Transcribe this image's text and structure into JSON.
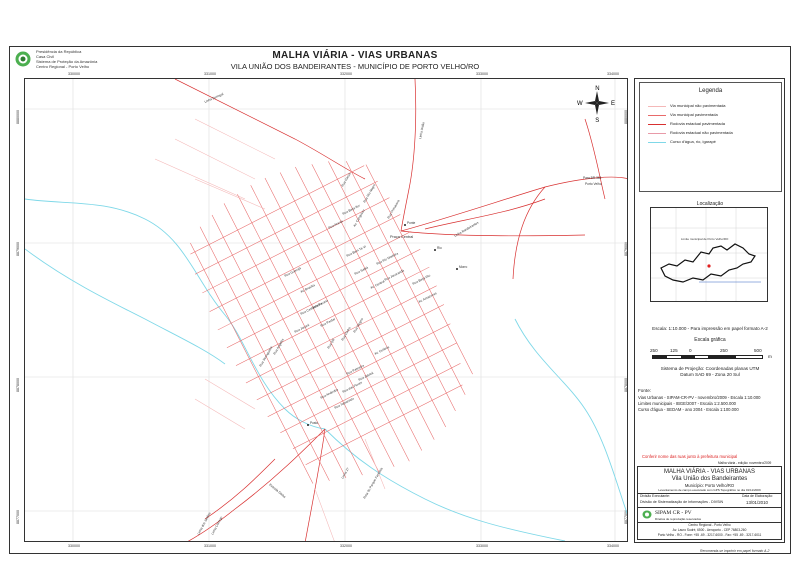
{
  "header": {
    "org_lines": [
      "Presidência da República",
      "Casa Civil",
      "Sistema de Proteção da Amazônia",
      "Centro Regional - Porto Velho"
    ],
    "title": "MALHA VIÁRIA - VIAS URBANAS",
    "subtitle": "VILA  UNIÃO DOS BANDEIRANTES -  MUNICÍPIO DE PORTO VELHO/RO"
  },
  "map": {
    "x_ticks": [
      "330000",
      "331000",
      "332000",
      "333000",
      "334000"
    ],
    "y_ticks": [
      "8880000",
      "8879000",
      "8878000",
      "8877000"
    ],
    "place_label": "Praça Central",
    "road_labels": {
      "ro_205": "Para BR-364",
      "porto_velho": "Porto Velho",
      "seringal": "Linha Seringal",
      "uniao": "Linha União",
      "bandeirantes": "Linha Bandeirantes",
      "jardins": "Linha dos Jardins",
      "corrego": "Linha Córrego",
      "estrada": "Estrada Gleba",
      "linha27": "Linha 27",
      "rota": "Rota do Parque Fantasia"
    },
    "street_labels": [
      "Rua Garça",
      "Rua Rio Negro",
      "Av. Cangussu",
      "Rua Beija-flor",
      "Rua Primavera",
      "Rua Araras",
      "Rua Bem-Te-Vi",
      "Rua Sabiá",
      "Av. Central",
      "Rua Guarujá",
      "Av. Brasília",
      "Rua Tucano",
      "Rua Pardal",
      "Rua Jacaré",
      "Rua Castanheira",
      "Rua Rio Madeira",
      "Rua Jacarandá",
      "Rua Beija-Rio",
      "Av. Amazonas",
      "Rua Ipê",
      "Rua Cedro",
      "Rua Mogno",
      "Rua Palmeira",
      "Rua das Flores",
      "Rua Jatobá",
      "Av. Goiânia",
      "Rua Seringueira",
      "Rua Angelim",
      "Rua Andiroba",
      "Rua Tamarindo"
    ],
    "point_labels": [
      "Rio",
      "Morro",
      "Posto",
      "Ponte"
    ],
    "compass": {
      "n": "N",
      "s": "S",
      "e": "E",
      "w": "W"
    }
  },
  "legend": {
    "title": "Legenda",
    "items": [
      {
        "label": "Via municipal não pavimentada",
        "color": "#f4b8b8"
      },
      {
        "label": "Via municipal pavimentada",
        "color": "#e86a6a"
      },
      {
        "label": "Rodovia estadual pavimentada",
        "color": "#d83030"
      },
      {
        "label": "Rodovia estadual não pavimentada",
        "color": "#e89aa8"
      },
      {
        "label": "Curso d'água, rio, igarapé",
        "color": "#7fd8e8"
      }
    ]
  },
  "location": {
    "title": "Localização",
    "caption": "Limite municipal de Porto Velho/RO"
  },
  "scale": {
    "text": "Escala: 1:10.000 - Para impressão em papel formato A-2",
    "graphic_title": "Escala gráfica",
    "ticks": [
      "250",
      "125",
      "0",
      "250",
      "500"
    ],
    "unit": "m"
  },
  "projection": {
    "line1": "Sistema de Projeção: Coordenadas planas UTM",
    "line2": "Datum SAD 69 - Zona 20 Sul"
  },
  "sources": {
    "title": "Fonte:",
    "lines": [
      "Vias Urbanas - SIPAM-CR-PV - novembro/2009 - Escala 1:10.000",
      "Limites municipais - IBGE/2007 - Escala 1:2.500.000",
      "Curso d'água - SEDAM - ano 2004 - Escala 1:100.000"
    ]
  },
  "note": "Conferir nome das ruas junto à prefeitura municipal",
  "note_small": "Malha viária - edição: novembro/2009",
  "title_block": {
    "title": "MALHA VIÁRIA - VIAS URBANAS",
    "subtitle": "Vila União dos Bandeirantes",
    "municipality": "Município: Porto Velho/RO",
    "survey": "Levantamento de campo executado com GPS Topográfico no dia 01/11/2009",
    "exec_label": "Divisão Executante:",
    "exec_value": "Divisão de Sistematização de Informações - DIVSIN",
    "date_label": "Data de Elaboração:",
    "date_value": "13/01/2010",
    "org_name": "SIPAM CR - PV",
    "org_sub": "Direitos de reprodução reservados",
    "address_lines": [
      "Centro Regional - Porto Velho",
      "Av. Lauro Sodré, 6500 - Aeroporto - CEP 76803-260",
      "Porto Velho - RO - Fone: +55 -69 - 3217-6000 - Fax: +55 -69 - 3217-6011"
    ]
  },
  "footer": "Recomenda-se imprimir em papel formato A-2"
}
